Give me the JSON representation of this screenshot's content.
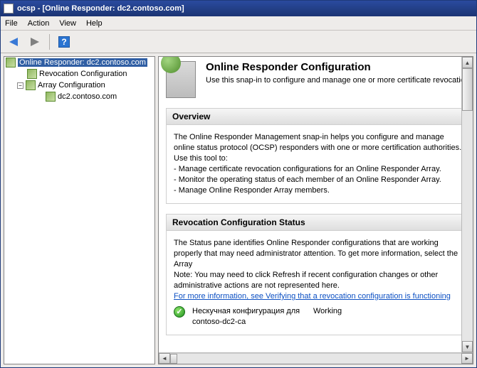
{
  "window": {
    "title": "ocsp - [Online Responder: dc2.contoso.com]"
  },
  "menu": {
    "file": "File",
    "action": "Action",
    "view": "View",
    "help": "Help"
  },
  "toolbar": {
    "back": "Back",
    "forward": "Forward",
    "help": "?"
  },
  "tree": {
    "root": "Online Responder: dc2.contoso.com",
    "revocation": "Revocation Configuration",
    "array": "Array Configuration",
    "array_child": "dc2.contoso.com",
    "expander_minus": "−"
  },
  "page": {
    "title": "Online Responder Configuration",
    "subtitle": "Use this snap-in to configure and manage one or more certificate revocation"
  },
  "overview": {
    "heading": "Overview",
    "intro1": "The Online Responder Management snap-in helps you configure and manage online status protocol (OCSP) responders with one or more certification authorities.",
    "intro2": "Use this tool to:",
    "b1": "-  Manage certificate revocation configurations for an Online Responder Array.",
    "b2": "-  Monitor the operating status of each member of an Online Responder Array.",
    "b3": "-  Manage Online Responder Array members."
  },
  "status": {
    "heading": "Revocation Configuration Status",
    "para": "The Status pane identifies Online Responder configurations that are working properly that may need administrator attention. To get more information, select the Array",
    "note": "Note: You may need to click Refresh if recent configuration changes or other administrative actions are not represented here.",
    "link": "For more information, see Verifying that a revocation configuration is functioning",
    "item_name": "Нескучная конфигурация для contoso-dc2-ca",
    "item_state": "Working",
    "check": "✓"
  }
}
